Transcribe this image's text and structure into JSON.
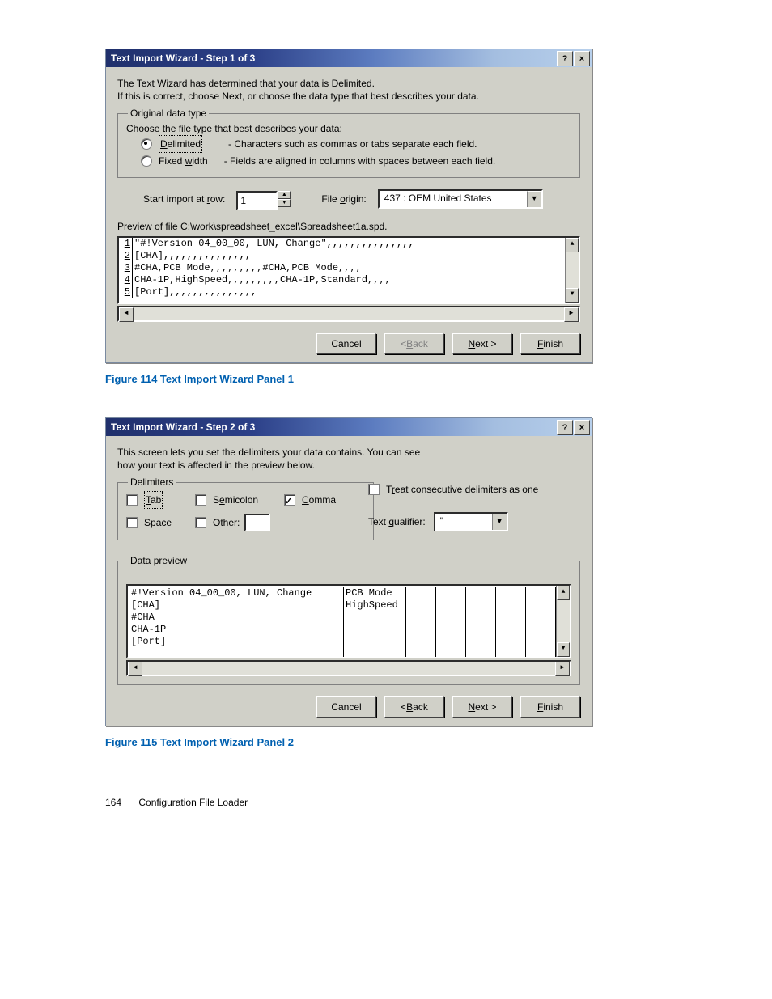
{
  "step1": {
    "title": "Text Import Wizard - Step 1 of 3",
    "intro1": "The Text Wizard has determined that your data is Delimited.",
    "intro2": "If this is correct, choose Next, or choose the data type that best describes your data.",
    "group_label": "Original data type",
    "group_hint": "Choose the file type that best describes your data:",
    "radio_delimited": "Delimited",
    "radio_delimited_desc": "- Characters such as commas or tabs separate each field.",
    "radio_fixed": "Fixed width",
    "radio_fixed_desc": "- Fields are aligned in columns with spaces between each field.",
    "radio_fixed_key": "w",
    "start_row_label": "Start import at row:",
    "start_row_key": "r",
    "start_row_value": "1",
    "file_origin_label": "File origin:",
    "file_origin_key": "o",
    "file_origin_value": "437 : OEM United States",
    "preview_label": "Preview of file C:\\work\\spreadsheet_excel\\Spreadsheet1a.spd.",
    "preview_lines": [
      "\"#!Version 04_00_00, LUN, Change\",,,,,,,,,,,,,,,",
      "[CHA],,,,,,,,,,,,,,,",
      "#CHA,PCB Mode,,,,,,,,,#CHA,PCB Mode,,,,",
      "CHA-1P,HighSpeed,,,,,,,,,CHA-1P,Standard,,,,",
      "[Port],,,,,,,,,,,,,,,"
    ],
    "btn_cancel": "Cancel",
    "btn_back": "< Back",
    "btn_next": "Next >",
    "btn_finish": "Finish",
    "back_key": "B",
    "next_key": "N",
    "finish_key": "F"
  },
  "caption1": "Figure 114 Text Import Wizard Panel 1",
  "step2": {
    "title": "Text Import Wizard - Step 2 of 3",
    "intro1": "This screen lets you set the delimiters your data contains.  You can see",
    "intro2": "how your text is affected in the preview below.",
    "group_delim": "Delimiters",
    "d_tab": "Tab",
    "d_semicolon": "Semicolon",
    "d_comma": "Comma",
    "d_space": "Space",
    "d_other": "Other:",
    "d_tab_key": "T",
    "d_semi_key": "e",
    "d_comma_key": "C",
    "d_space_key": "S",
    "d_other_key": "O",
    "treat_label": "Treat consecutive delimiters as one",
    "treat_key": "r",
    "text_qual_label": "Text qualifier:",
    "text_qual_key": "q",
    "text_qual_value": "\"",
    "group_preview": "Data preview",
    "preview_key": "p",
    "col0": [
      "#!Version 04_00_00, LUN, Change",
      "[CHA]",
      "#CHA",
      "CHA-1P",
      "[Port]"
    ],
    "col1": [
      "",
      "",
      "PCB Mode",
      "HighSpeed",
      ""
    ],
    "btn_cancel": "Cancel",
    "btn_back": "< Back",
    "btn_next": "Next >",
    "btn_finish": "Finish",
    "back_key": "B",
    "next_key": "N",
    "finish_key": "F"
  },
  "caption2": "Figure 115 Text Import Wizard Panel 2",
  "footer": {
    "page": "164",
    "chapter": "Configuration File Loader"
  }
}
